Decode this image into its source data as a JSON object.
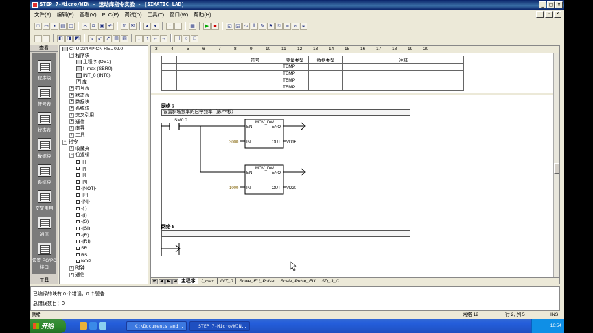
{
  "window": {
    "title": "STEP 7-Micro/WIN - 运动库指令实验 - [SIMATIC LAD]",
    "min": "_",
    "max": "□",
    "close": "×"
  },
  "menu": {
    "items": [
      "文件(F)",
      "编辑(E)",
      "查看(V)",
      "PLC(P)",
      "调试(D)",
      "工具(T)",
      "窗口(W)",
      "帮助(H)"
    ],
    "doc_min": "_",
    "doc_restore": "▫",
    "doc_close": "×"
  },
  "navbar": {
    "header": "查看",
    "footer": "工具",
    "items": [
      "程序块",
      "符号表",
      "状态表",
      "数据块",
      "系统块",
      "交叉引用",
      "通信",
      "设置 PG/PC 接口"
    ]
  },
  "tree": {
    "rows": [
      {
        "text": "CPU 224XP CN REL 02.0",
        "indent": 0,
        "kind": "ic"
      },
      {
        "text": "程序块",
        "indent": 1,
        "kind": "ex",
        "sign": "−"
      },
      {
        "text": "主程序 (OB1)",
        "indent": 2,
        "kind": "ic"
      },
      {
        "text": "f_max (SBR0)",
        "indent": 2,
        "kind": "ic"
      },
      {
        "text": "INT_0 (INT0)",
        "indent": 2,
        "kind": "ic"
      },
      {
        "text": "库",
        "indent": 2,
        "kind": "ex",
        "sign": "+"
      },
      {
        "text": "符号表",
        "indent": 1,
        "kind": "ex",
        "sign": "+"
      },
      {
        "text": "状态表",
        "indent": 1,
        "kind": "ex",
        "sign": "+"
      },
      {
        "text": "数据块",
        "indent": 1,
        "kind": "ex",
        "sign": "+"
      },
      {
        "text": "系统块",
        "indent": 1,
        "kind": "ex",
        "sign": "+"
      },
      {
        "text": "交叉引用",
        "indent": 1,
        "kind": "ex",
        "sign": "+"
      },
      {
        "text": "通信",
        "indent": 1,
        "kind": "ex",
        "sign": "+"
      },
      {
        "text": "向导",
        "indent": 1,
        "kind": "ex",
        "sign": "+"
      },
      {
        "text": "工具",
        "indent": 1,
        "kind": "ex",
        "sign": "+"
      },
      {
        "text": "指令",
        "indent": 0,
        "kind": "ex",
        "sign": "−"
      },
      {
        "text": "收藏夹",
        "indent": 1,
        "kind": "ex",
        "sign": "+"
      },
      {
        "text": "位逻辑",
        "indent": 1,
        "kind": "ex",
        "sign": "−"
      },
      {
        "text": "-| |-",
        "indent": 2,
        "kind": "sq"
      },
      {
        "text": "-|/|-",
        "indent": 2,
        "kind": "sq"
      },
      {
        "text": "-|I|-",
        "indent": 2,
        "kind": "sq"
      },
      {
        "text": "-|/I|-",
        "indent": 2,
        "kind": "sq"
      },
      {
        "text": "-|NOT|-",
        "indent": 2,
        "kind": "sq"
      },
      {
        "text": "-|P|-",
        "indent": 2,
        "kind": "sq"
      },
      {
        "text": "-|N|-",
        "indent": 2,
        "kind": "sq"
      },
      {
        "text": "-( )",
        "indent": 2,
        "kind": "sq"
      },
      {
        "text": "-(I)",
        "indent": 2,
        "kind": "sq"
      },
      {
        "text": "-(S)",
        "indent": 2,
        "kind": "sq"
      },
      {
        "text": "-(SI)",
        "indent": 2,
        "kind": "sq"
      },
      {
        "text": "-(R)",
        "indent": 2,
        "kind": "sq"
      },
      {
        "text": "-(RI)",
        "indent": 2,
        "kind": "sq"
      },
      {
        "text": "SR",
        "indent": 2,
        "kind": "sq"
      },
      {
        "text": "RS",
        "indent": 2,
        "kind": "sq"
      },
      {
        "text": "NOP",
        "indent": 2,
        "kind": "sq"
      },
      {
        "text": "时钟",
        "indent": 1,
        "kind": "ex",
        "sign": "+"
      },
      {
        "text": "通信",
        "indent": 1,
        "kind": "ex",
        "sign": "+"
      }
    ]
  },
  "ruler": [
    "3",
    "4",
    "5",
    "6",
    "7",
    "8",
    "9",
    "10",
    "11",
    "12",
    "13",
    "14",
    "15",
    "16",
    "17",
    "18",
    "19",
    "20"
  ],
  "vartable": {
    "headers": [
      "符号",
      "变量类型",
      "数据类型",
      "注释"
    ],
    "rows": [
      "TEMP",
      "TEMP",
      "TEMP",
      "TEMP"
    ]
  },
  "network7": {
    "label": "网络 7",
    "comment": "设置斜坡频率的启停频率（脉冲/秒）",
    "contact": "SM0.0",
    "box1": {
      "title": "MOV_DW",
      "en": "EN",
      "eno": "ENO",
      "in": "IN",
      "out": "OUT",
      "in_val": "3000",
      "out_val": "VD16"
    },
    "box2": {
      "title": "MOV_DW",
      "en": "EN",
      "eno": "ENO",
      "in": "IN",
      "out": "OUT",
      "in_val": "1000",
      "out_val": "VD20"
    }
  },
  "network8": {
    "label": "网络 8"
  },
  "tabs": [
    "主程序",
    "f_max",
    "INT_0",
    "Scale_EU_Pulse",
    "Scale_Pulse_EU",
    "SD_3_C"
  ],
  "output": {
    "line1": "已编译的块有 0 个错误，0 个警告",
    "line2": "总错误数目：0"
  },
  "status": {
    "left": "就绪",
    "network": "网络 12",
    "pos": "行 2, 列 5",
    "mode": "INS"
  },
  "taskbar": {
    "start": "开始",
    "task1": "C:\\Documents and ...",
    "task2": "STEP 7-Micro/WIN...",
    "clock": "16:54"
  }
}
